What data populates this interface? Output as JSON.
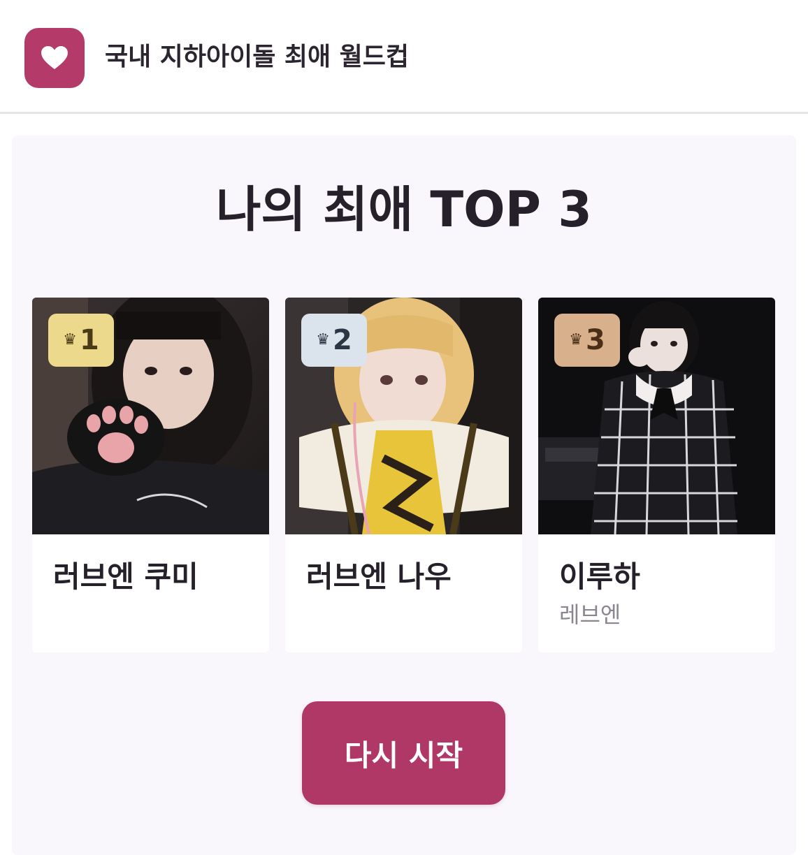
{
  "header": {
    "app_title": "국내 지하아이돌 최애 월드컵",
    "logo_icon": "heart-icon",
    "logo_color": "#b43a6a"
  },
  "main": {
    "title": "나의 최애 TOP 3",
    "results": [
      {
        "rank": "1",
        "rank_icon": "crown-icon",
        "badge_color": "#ecd98c",
        "badge_text_color": "#4a3a16",
        "name": "러브엔 쿠미",
        "group": "",
        "photo": "idol-photo-1"
      },
      {
        "rank": "2",
        "rank_icon": "crown-icon",
        "badge_color": "#dbe4ec",
        "badge_text_color": "#2b3644",
        "name": "러브엔 나우",
        "group": "",
        "photo": "idol-photo-2"
      },
      {
        "rank": "3",
        "rank_icon": "crown-icon",
        "badge_color": "#d8b08c",
        "badge_text_color": "#4a2e18",
        "name": "이루하",
        "group": "레브엔",
        "photo": "idol-photo-3"
      }
    ],
    "restart_label": "다시 시작",
    "restart_color": "#b03866"
  }
}
